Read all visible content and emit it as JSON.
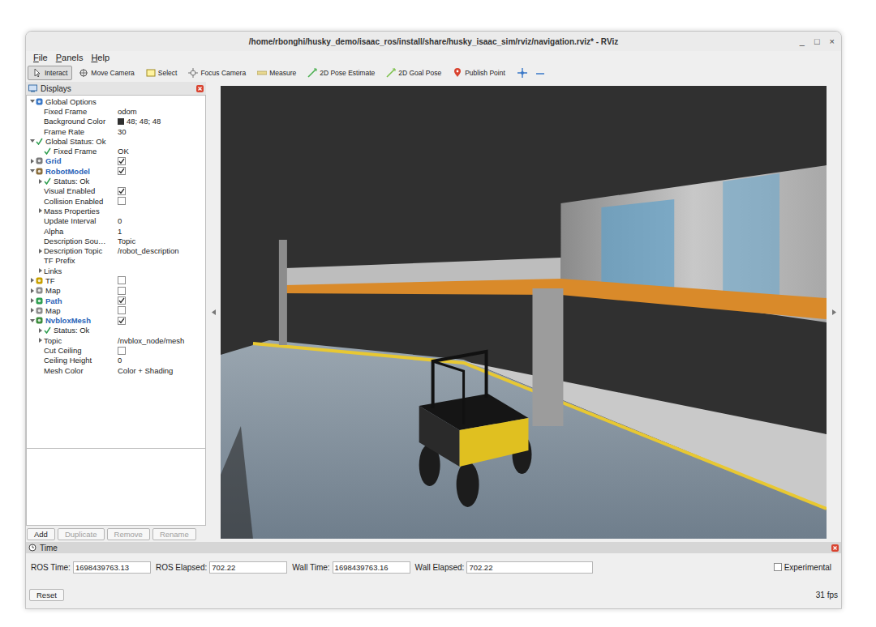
{
  "window": {
    "title": "/home/rbonghi/husky_demo/isaac_ros/install/share/husky_isaac_sim/rviz/navigation.rviz* - RViz",
    "controls": [
      "_",
      "□",
      "×"
    ]
  },
  "menu": [
    "File",
    "Panels",
    "Help"
  ],
  "toolbar": [
    {
      "label": "Interact",
      "selected": true
    },
    {
      "label": "Move Camera",
      "selected": false
    },
    {
      "label": "Select",
      "selected": false
    },
    {
      "label": "Focus Camera",
      "selected": false
    },
    {
      "label": "Measure",
      "selected": false
    },
    {
      "label": "2D Pose Estimate",
      "selected": false
    },
    {
      "label": "2D Goal Pose",
      "selected": false
    },
    {
      "label": "Publish Point",
      "selected": false
    }
  ],
  "displays": {
    "title": "Displays",
    "items": [
      {
        "kind": "group",
        "label": "Global Options",
        "value": "",
        "expandable": true,
        "expanded": true,
        "color": "#3a78c8",
        "children": [
          {
            "kind": "property",
            "label": "Fixed Frame",
            "value": "odom",
            "expandable": false,
            "expanded": false
          },
          {
            "kind": "property",
            "label": "Background Color",
            "value": "48; 48; 48",
            "expandable": false,
            "expanded": false,
            "color": "#303030"
          },
          {
            "kind": "property",
            "label": "Frame Rate",
            "value": "30",
            "expandable": false,
            "expanded": false
          }
        ]
      },
      {
        "kind": "status",
        "label": "Global Status: Ok",
        "value": "",
        "expandable": true,
        "expanded": true,
        "children": [
          {
            "kind": "status",
            "label": "Fixed Frame",
            "value": "OK",
            "expandable": false,
            "expanded": false
          }
        ]
      },
      {
        "kind": "display",
        "label": "Grid",
        "value": "",
        "expandable": true,
        "expanded": false,
        "checked": true,
        "color": "#7a7a7a"
      },
      {
        "kind": "display",
        "label": "RobotModel",
        "value": "",
        "expandable": true,
        "expanded": true,
        "checked": true,
        "color": "#8a6d3b",
        "children": [
          {
            "kind": "status",
            "label": "Status: Ok",
            "value": "",
            "expandable": true,
            "expanded": false
          },
          {
            "kind": "check-property",
            "label": "Visual Enabled",
            "value": "",
            "expandable": false,
            "expanded": false,
            "checked": true
          },
          {
            "kind": "check-property",
            "label": "Collision Enabled",
            "value": "",
            "expandable": false,
            "expanded": false,
            "checked": false
          },
          {
            "kind": "property",
            "label": "Mass Properties",
            "value": "",
            "expandable": true,
            "expanded": false
          },
          {
            "kind": "property",
            "label": "Update Interval",
            "value": "0",
            "expandable": false,
            "expanded": false
          },
          {
            "kind": "property",
            "label": "Alpha",
            "value": "1",
            "expandable": false,
            "expanded": false
          },
          {
            "kind": "property",
            "label": "Description Sou…",
            "value": "Topic",
            "expandable": false,
            "expanded": false
          },
          {
            "kind": "property",
            "label": "Description Topic",
            "value": "/robot_description",
            "expandable": true,
            "expanded": false
          },
          {
            "kind": "property",
            "label": "TF Prefix",
            "value": "",
            "expandable": false,
            "expanded": false
          },
          {
            "kind": "property",
            "label": "Links",
            "value": "",
            "expandable": true,
            "expanded": false
          }
        ]
      },
      {
        "kind": "display",
        "label": "TF",
        "value": "",
        "expandable": true,
        "expanded": false,
        "checked": false,
        "color": "#c8a000"
      },
      {
        "kind": "display",
        "label": "Map",
        "value": "",
        "expandable": true,
        "expanded": false,
        "checked": false,
        "color": "#8c8c8c"
      },
      {
        "kind": "display",
        "label": "Path",
        "value": "",
        "expandable": true,
        "expanded": false,
        "checked": true,
        "color": "#2e9e4f"
      },
      {
        "kind": "display",
        "label": "Map",
        "value": "",
        "expandable": true,
        "expanded": false,
        "checked": false,
        "color": "#8c8c8c"
      },
      {
        "kind": "display",
        "label": "NvbloxMesh",
        "value": "",
        "expandable": true,
        "expanded": true,
        "checked": true,
        "color": "#3c8c3c",
        "children": [
          {
            "kind": "status",
            "label": "Status: Ok",
            "value": "",
            "expandable": true,
            "expanded": false
          },
          {
            "kind": "property",
            "label": "Topic",
            "value": "/nvblox_node/mesh",
            "expandable": true,
            "expanded": false
          },
          {
            "kind": "check-property",
            "label": "Cut Ceiling",
            "value": "",
            "expandable": false,
            "expanded": false,
            "checked": false
          },
          {
            "kind": "property",
            "label": "Ceiling Height",
            "value": "0",
            "expandable": false,
            "expanded": false
          },
          {
            "kind": "property",
            "label": "Mesh Color",
            "value": "Color + Shading",
            "expandable": false,
            "expanded": false
          }
        ]
      }
    ],
    "buttons": [
      {
        "label": "Add",
        "disabled": false
      },
      {
        "label": "Duplicate",
        "disabled": true
      },
      {
        "label": "Remove",
        "disabled": true
      },
      {
        "label": "Rename",
        "disabled": true
      }
    ]
  },
  "time": {
    "title": "Time",
    "fields": [
      {
        "label": "ROS Time:",
        "value": "1698439763.13"
      },
      {
        "label": "ROS Elapsed:",
        "value": "702.22"
      },
      {
        "label": "Wall Time:",
        "value": "1698439763.16"
      },
      {
        "label": "Wall Elapsed:",
        "value": "702.22"
      }
    ],
    "experimental": {
      "label": "Experimental",
      "checked": false
    },
    "reset": "Reset",
    "fps": "31 fps"
  }
}
